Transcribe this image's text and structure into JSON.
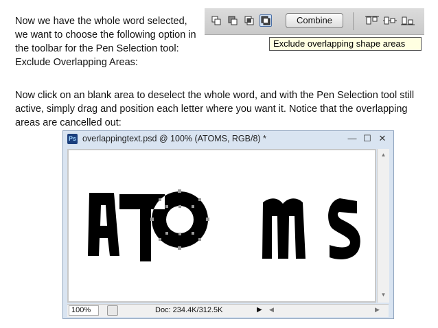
{
  "instructions": {
    "paragraph1": "Now we have the whole word selected, we want to choose the following option in the toolbar for the Pen Selection tool: Exclude Overlapping Areas:",
    "paragraph2": "Now click on an blank area to deselect the whole word, and with the Pen Selection tool still active, simply drag and position each letter where you want it. Notice that the overlapping areas are cancelled out:"
  },
  "toolbar": {
    "combine_label": "Combine",
    "mode_buttons": [
      "add-to-shape-area",
      "subtract-from-shape-area",
      "intersect-shape-areas",
      "exclude-overlapping-shape-areas"
    ],
    "active_mode": "exclude-overlapping-shape-areas",
    "tooltip": "Exclude overlapping shape areas"
  },
  "document_window": {
    "app_icon": "Ps",
    "title": "overlappingtext.psd @ 100% (ATOMS, RGB/8) *",
    "controls": {
      "minimize": "—",
      "maximize": "☐",
      "close": "✕"
    },
    "status": {
      "zoom": "100%",
      "doc_info": "Doc: 234.4K/312.5K"
    }
  }
}
